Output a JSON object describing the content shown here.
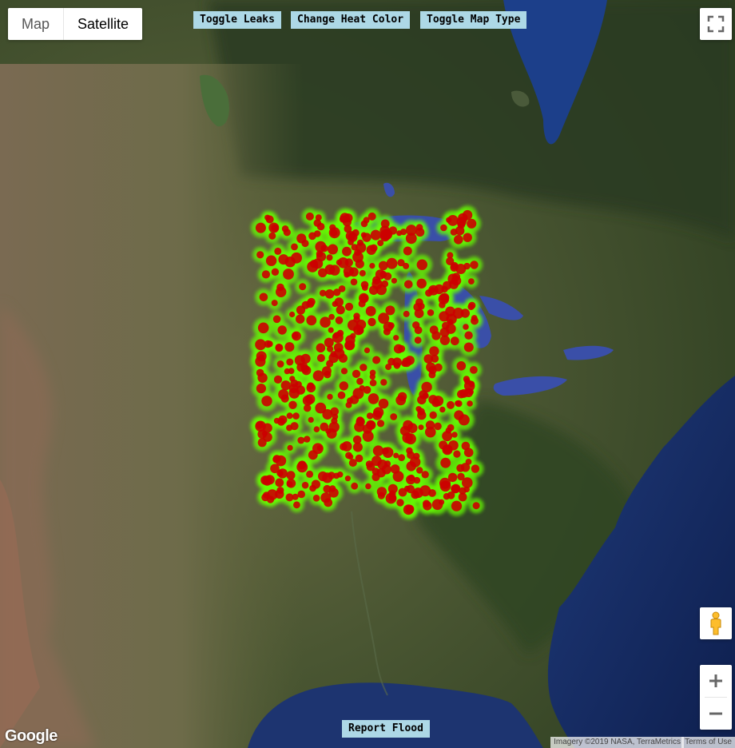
{
  "map_type": {
    "options": [
      "Map",
      "Satellite"
    ],
    "selected": "Satellite"
  },
  "buttons": {
    "toggle_leaks": "Toggle Leaks",
    "change_heat_color": "Change Heat Color",
    "toggle_map_type": "Toggle Map Type",
    "report_flood": "Report Flood"
  },
  "logo": "Google",
  "attribution": {
    "imagery": "Imagery ©2019 NASA, TerraMetrics",
    "terms": "Terms of Use"
  },
  "icons": {
    "fullscreen": "fullscreen-icon",
    "pegman": "pegman-icon",
    "zoom_in": "plus-icon",
    "zoom_out": "minus-icon"
  },
  "colors": {
    "button_bg": "#add8e6",
    "heat_low": "#66ff00",
    "heat_high": "#cc0000"
  }
}
